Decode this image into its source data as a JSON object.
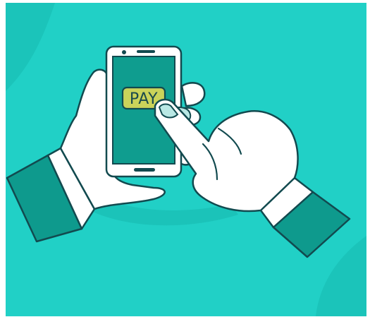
{
  "illustration": {
    "button_label": "PAY",
    "icon": "hand-tapping-phone-pay-illustration",
    "colors": {
      "background": "#21d0c6",
      "background_shape": "#1bc4ba",
      "outline": "#124a4f",
      "screen": "#0f9d8f",
      "sleeve": "#0e9a8d",
      "pay_button": "#cbd35a",
      "skin": "#ffffff"
    }
  }
}
